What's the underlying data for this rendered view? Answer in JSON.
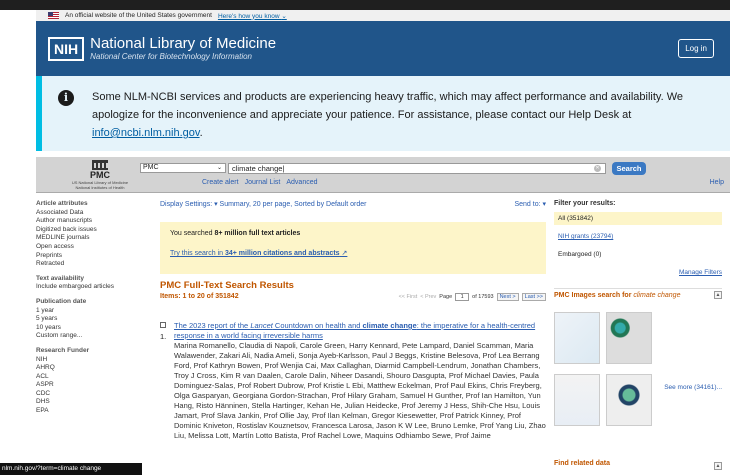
{
  "gov_banner": {
    "text": "An official website of the United States government",
    "link": "Here's how you know"
  },
  "header": {
    "logo": "NIH",
    "title": "National Library of Medicine",
    "subtitle": "National Center for Biotechnology Information",
    "login": "Log in"
  },
  "alert": {
    "line1": "Some NLM-NCBI services and products are experiencing heavy traffic, which may affect performance and availability. We",
    "line2": "apologize for the inconvenience and appreciate your patience. For assistance, please contact our Help Desk at",
    "email": "info@ncbi.nlm.nih.gov",
    "tail": "."
  },
  "search": {
    "logo": "PMC",
    "logo_sub1": "US National Library of Medicine",
    "logo_sub2": "National Institutes of Health",
    "database": "PMC",
    "query": "climate change",
    "button": "Search",
    "create_alert": "Create alert",
    "journal_list": "Journal List",
    "advanced": "Advanced",
    "help": "Help"
  },
  "left": [
    {
      "head": "Article attributes",
      "items": [
        "Associated Data",
        "Author manuscripts",
        "Digitized back issues",
        "MEDLINE journals",
        "Open access",
        "Preprints",
        "Retracted"
      ]
    },
    {
      "head": "Text availability",
      "items": [
        "Include embargoed articles"
      ]
    },
    {
      "head": "Publication date",
      "items": [
        "1 year",
        "5 years",
        "10 years",
        "Custom range..."
      ]
    },
    {
      "head": "Research Funder",
      "items": [
        "NIH",
        "AHRQ",
        "ACL",
        "ASPR",
        "CDC",
        "DHS",
        "EPA"
      ]
    }
  ],
  "main": {
    "display_settings": "Display Settings: ▾ Summary, 20 per page, Sorted by Default order",
    "send_to": "Send to: ▾",
    "searched_pre": "You searched ",
    "searched_bold": "8+ million full text articles",
    "try_pre": "Try this search in ",
    "try_bold": "34+ million citations and abstracts",
    "results_title": "PMC Full-Text Search Results",
    "items": "Items: 1 to 20 of 351842",
    "pager": {
      "first": "<< First",
      "prev": "< Prev",
      "page_label": "Page",
      "page": "1",
      "of": "of 17593",
      "next": "Next >",
      "last": "Last >>"
    },
    "result1": {
      "num": "1.",
      "title_a": "The 2023 report of the ",
      "title_b": "Lancet",
      "title_c": " Countdown on health and ",
      "title_d": "climate change",
      "title_e": ": the imperative for a health-centred response in a world facing irreversible harms",
      "authors": "Marina Romanello, Claudia di Napoli, Carole Green, Harry Kennard, Pete Lampard, Daniel Scamman, Maria Walawender, Zakari Ali, Nadia Ameli, Sonja Ayeb-Karlsson, Paul J Beggs, Kristine Belesova, Prof Lea Berrang Ford, Prof Kathryn Bowen, Prof Wenjia Cai, Max Callaghan, Diarmid Campbell-Lendrum, Jonathan Chambers, Troy J Cross, Kim R van Daalen, Carole Dalin, Niheer Dasandi, Shouro Dasgupta, Prof Michael Davies, Paula Dominguez-Salas, Prof Robert Dubrow, Prof Kristie L Ebi, Matthew Eckelman, Prof Paul Ekins, Chris Freyberg, Olga Gasparyan, Georgiana Gordon-Strachan, Prof Hilary Graham, Samuel H Gunther, Prof Ian Hamilton, Yun Hang, Risto Hänninen, Stella Hartinger, Kehan He, Julian Heidecke, Prof Jeremy J Hess, Shih-Che Hsu, Louis Jamart, Prof Slava Jankin, Prof Ollie Jay, Prof Ilan Kelman, Gregor Kiesewetter, Prof Patrick Kinney, Prof Dominic Kniveton, Rostislav Kouznetsov, Francesca Larosa, Jason K W Lee, Bruno Lemke, Prof Yang Liu, Zhao Liu, Melissa Lott, Martín Lotto Batista, Prof Rachel Lowe, Maquins Odhiambo Sewe, Prof Jaime"
    }
  },
  "right": {
    "filter_title": "Filter your results:",
    "all": "All (351842)",
    "nih_grants": "NIH grants (23794)",
    "embargoed": "Embargoed (0)",
    "manage": "Manage Filters",
    "images_title": "PMC Images search for ",
    "images_query": "climate change",
    "see_more": "See more (34161)...",
    "find_related": "Find related data"
  },
  "status_url": "nlm.nih.gov/?term=climate change"
}
